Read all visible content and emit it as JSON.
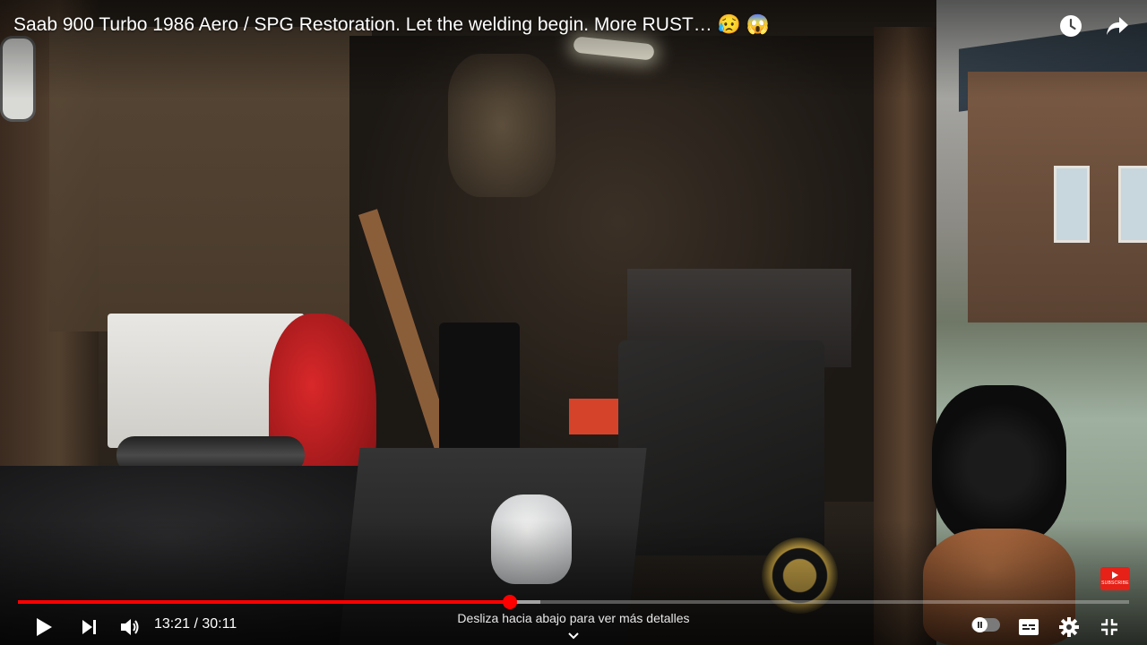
{
  "video": {
    "title": "Saab 900 Turbo 1986 Aero / SPG Restoration. Let the welding begin. More RUST… 😥 😱"
  },
  "top_bar": {
    "icons": [
      "clock-icon",
      "share-icon"
    ]
  },
  "watermark": {
    "icon": "subscribe-badge-icon",
    "label": "SUBSCRIBE",
    "color": "#e62117"
  },
  "player": {
    "current_time": "13:21",
    "duration": "30:11",
    "time_display": "13:21 / 30:11",
    "progress_fraction": 0.443,
    "buffered_fraction": 0.47,
    "accent_color": "#ff0000",
    "swipe_hint": "Desliza hacia abajo para ver más detalles",
    "controls": [
      "play-icon",
      "next-icon",
      "volume-icon",
      "autoplay-toggle",
      "captions-icon",
      "settings-icon",
      "fullscreen-icon"
    ]
  }
}
